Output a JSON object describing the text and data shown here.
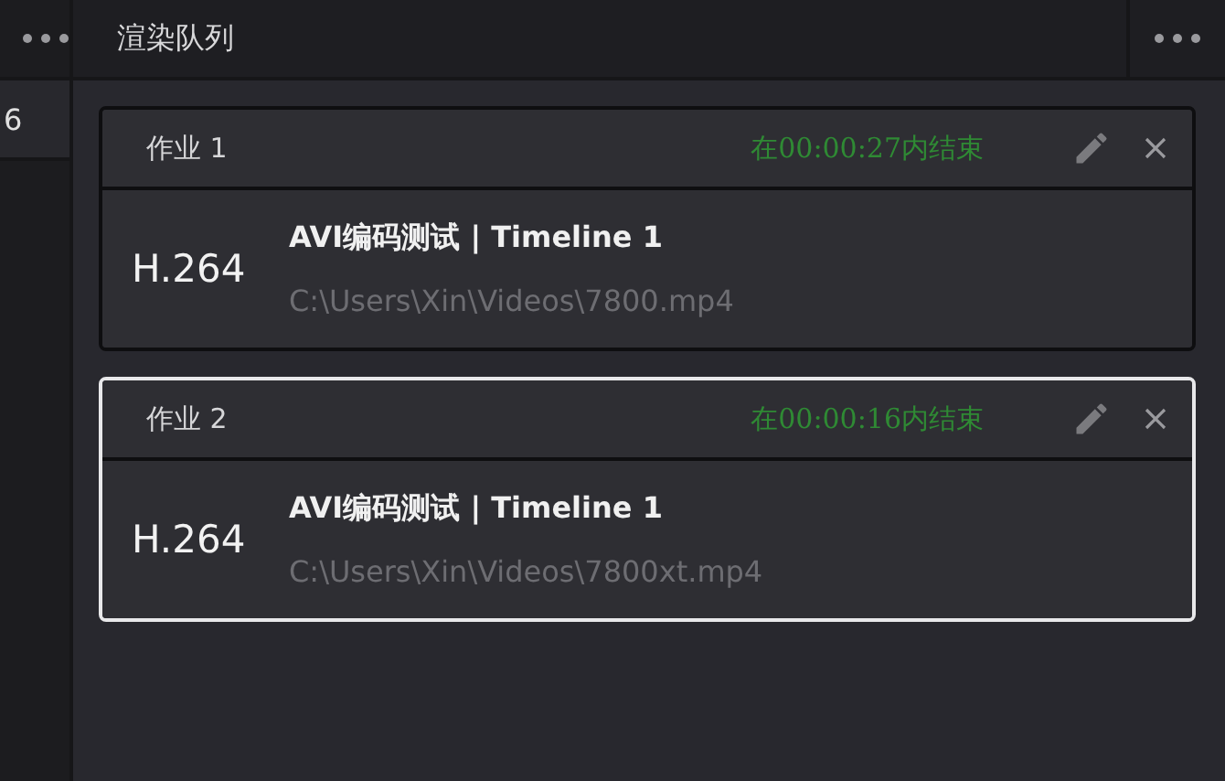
{
  "left_panel": {
    "cut_text": "6"
  },
  "render_queue": {
    "title": "渲染队列",
    "jobs": [
      {
        "name": "作业 1",
        "eta": "在00:00:27内结束",
        "codec": "H.264",
        "title": "AVI编码测试 | Timeline 1",
        "path": "C:\\Users\\Xin\\Videos\\7800.mp4",
        "selected": false
      },
      {
        "name": "作业 2",
        "eta": "在00:00:16内结束",
        "codec": "H.264",
        "title": "AVI编码测试 | Timeline 1",
        "path": "C:\\Users\\Xin\\Videos\\7800xt.mp4",
        "selected": true
      }
    ]
  }
}
